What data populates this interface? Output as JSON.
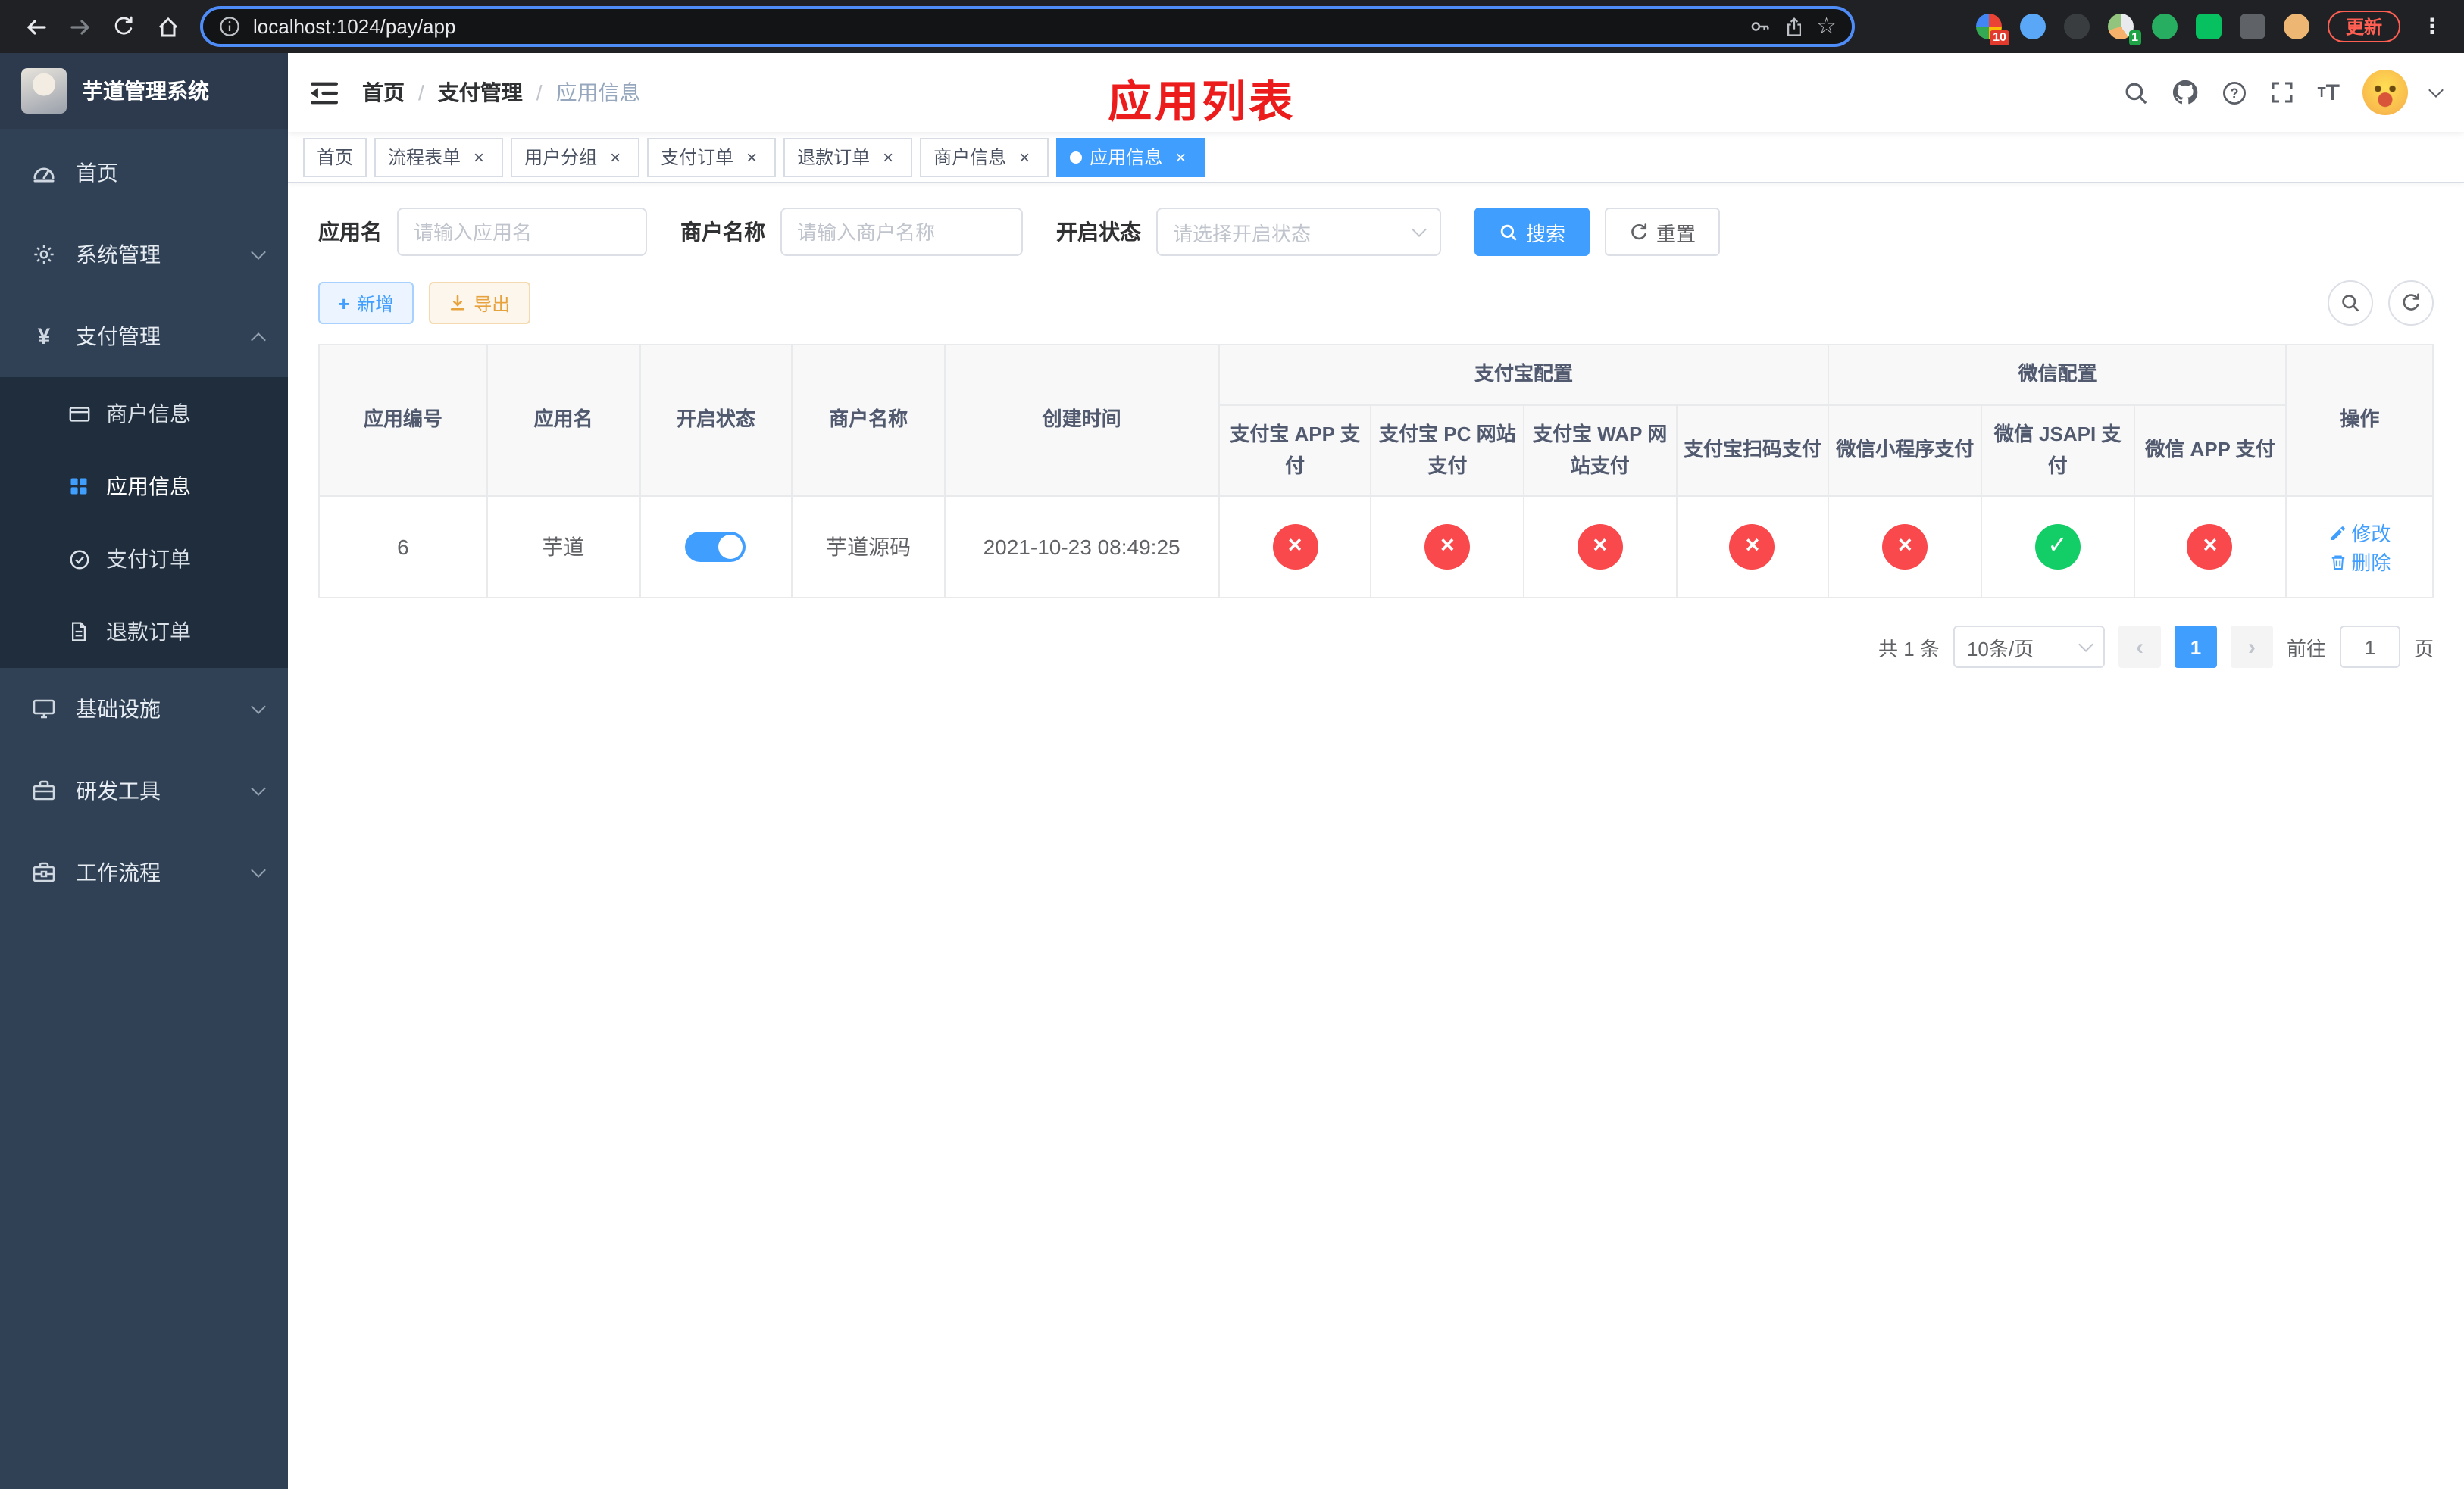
{
  "colors": {
    "accent": "#409eff",
    "success": "#13ce66",
    "danger": "#f9494c",
    "warning": "#e6a23c",
    "annotation": "#ed1c1c",
    "sidebar_bg": "#304156",
    "submenu_bg": "#1f2d3d"
  },
  "browser": {
    "url": "localhost:1024/pay/app",
    "update_label": "更新",
    "extension_badges": {
      "first": "10",
      "fourth": "1"
    }
  },
  "sidebar": {
    "title": "芋道管理系统",
    "items": [
      {
        "label": "首页",
        "icon": "dashboard-icon",
        "expandable": false
      },
      {
        "label": "系统管理",
        "icon": "gear-icon",
        "expandable": true
      },
      {
        "label": "支付管理",
        "icon": "yen-icon",
        "icon_glyph": "¥",
        "expandable": true,
        "expanded": true,
        "children": [
          {
            "label": "商户信息",
            "icon": "bank-card-icon",
            "active": false
          },
          {
            "label": "应用信息",
            "icon": "grid-icon",
            "active": true
          },
          {
            "label": "支付订单",
            "icon": "order-icon",
            "active": false
          },
          {
            "label": "退款订单",
            "icon": "document-icon",
            "active": false
          }
        ]
      },
      {
        "label": "基础设施",
        "icon": "monitor-icon",
        "expandable": true
      },
      {
        "label": "研发工具",
        "icon": "toolbox-icon",
        "expandable": true
      },
      {
        "label": "工作流程",
        "icon": "workflow-icon",
        "expandable": true
      }
    ]
  },
  "header": {
    "breadcrumb": [
      "首页",
      "支付管理",
      "应用信息"
    ],
    "annotation": "应用列表",
    "icons": [
      "search-icon",
      "github-icon",
      "help-icon",
      "fullscreen-icon",
      "font-size-icon",
      "avatar",
      "caret-down-icon"
    ]
  },
  "tabs": [
    {
      "label": "首页",
      "closable": false,
      "active": false
    },
    {
      "label": "流程表单",
      "closable": true,
      "active": false
    },
    {
      "label": "用户分组",
      "closable": true,
      "active": false
    },
    {
      "label": "支付订单",
      "closable": true,
      "active": false
    },
    {
      "label": "退款订单",
      "closable": true,
      "active": false
    },
    {
      "label": "商户信息",
      "closable": true,
      "active": false
    },
    {
      "label": "应用信息",
      "closable": true,
      "active": true
    }
  ],
  "filters": {
    "app_name_label": "应用名",
    "app_name_placeholder": "请输入应用名",
    "app_name_value": "",
    "merchant_label": "商户名称",
    "merchant_placeholder": "请输入商户名称",
    "merchant_value": "",
    "status_label": "开启状态",
    "status_placeholder": "请选择开启状态",
    "search_label": "搜索",
    "reset_label": "重置"
  },
  "toolbar": {
    "add_label": "新增",
    "export_label": "导出"
  },
  "table": {
    "columns": [
      "应用编号",
      "应用名",
      "开启状态",
      "商户名称",
      "创建时间",
      "操作"
    ],
    "group_headers": {
      "alipay": "支付宝配置",
      "wechat": "微信配置"
    },
    "sub_columns": [
      "支付宝 APP 支付",
      "支付宝 PC 网站支付",
      "支付宝 WAP 网站支付",
      "支付宝扫码支付",
      "微信小程序支付",
      "微信 JSAPI 支付",
      "微信 APP 支付"
    ],
    "rows": [
      {
        "id": "6",
        "name": "芋道",
        "enabled": true,
        "merchant": "芋道源码",
        "created": "2021-10-23 08:49:25",
        "statuses": [
          "error",
          "error",
          "error",
          "error",
          "error",
          "success",
          "error"
        ],
        "edit_label": "修改",
        "delete_label": "删除"
      }
    ]
  },
  "pagination": {
    "total": "共 1 条",
    "page_size": "10条/页",
    "current_page": "1",
    "goto_label": "前往",
    "goto_value": "1",
    "goto_suffix": "页"
  }
}
